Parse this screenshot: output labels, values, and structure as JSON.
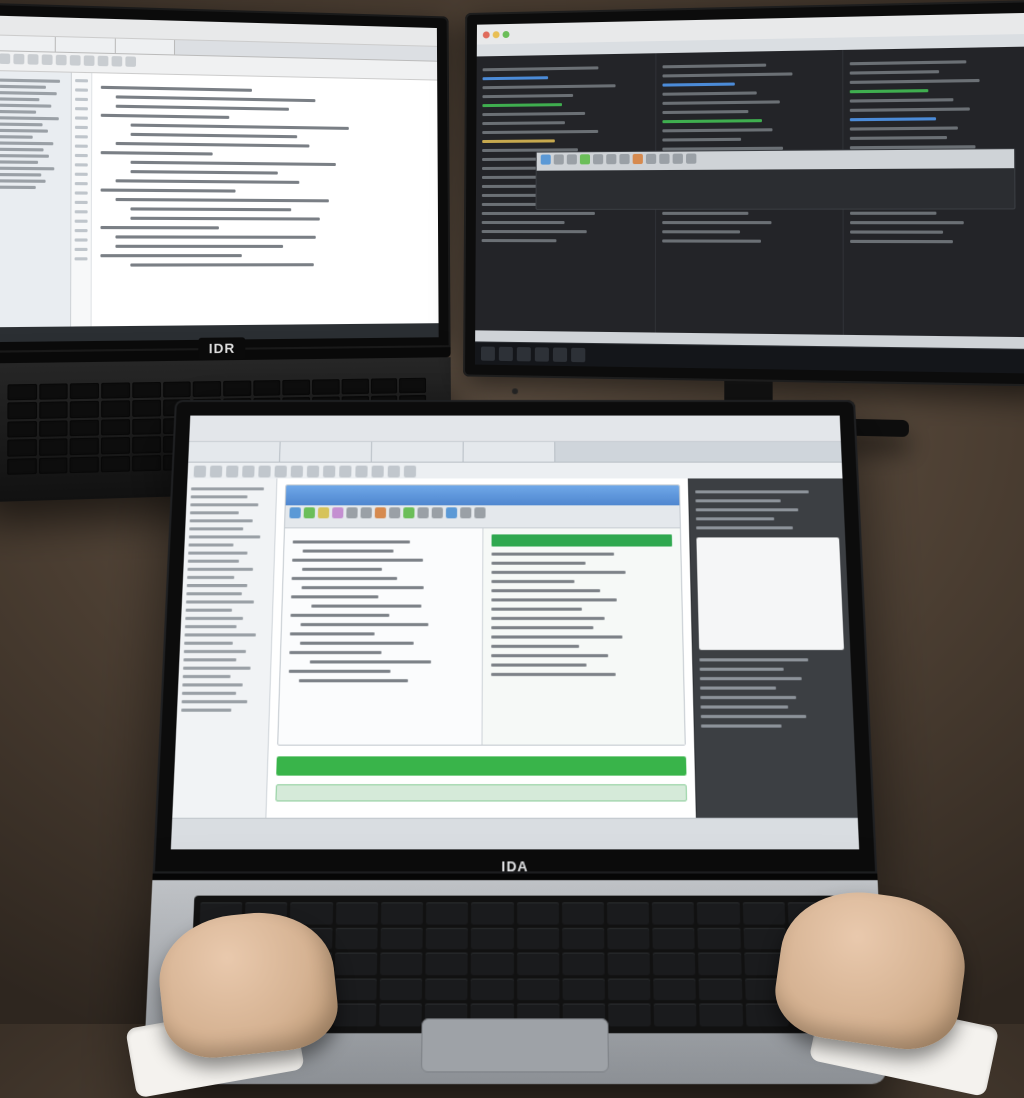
{
  "scene": {
    "description": "Photograph of a person using a silver laptop in the foreground with two additional computer screens behind it on a wooden desk. All screens show software/IDE interfaces with text too small and blurred to read.",
    "devices": [
      "laptop-back-left",
      "monitor-back-right",
      "laptop-foreground"
    ]
  },
  "laptop_back_left": {
    "brand_label": "IDR",
    "screen_theme": "light",
    "content": "code editor with sidebar and line gutter — text illegible"
  },
  "monitor_back_right": {
    "screen_theme": "dark",
    "content": "dark IDE, three code columns plus toolbar window and taskbar — text illegible"
  },
  "laptop_foreground": {
    "brand_label": "IDA",
    "screen_theme": "light",
    "content": "IDE with file tree, main editor containing a blue-titled sub-window split into two panes, green status bars, dark side panel — text illegible",
    "green_status_bar": true
  }
}
